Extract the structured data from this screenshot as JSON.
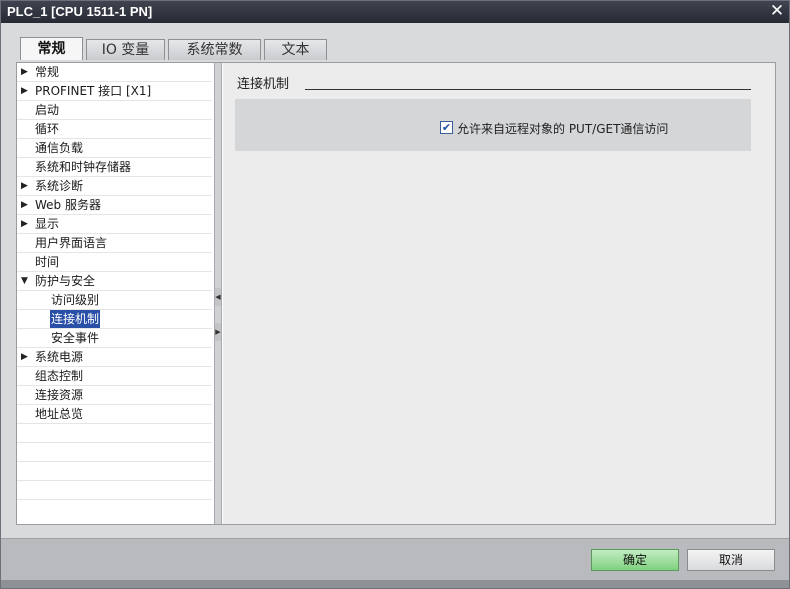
{
  "window": {
    "title": "PLC_1 [CPU 1511-1 PN]",
    "close_symbol": "✕"
  },
  "tabs": [
    {
      "label": "常规",
      "active": true
    },
    {
      "label": "IO 变量",
      "active": false
    },
    {
      "label": "系统常数",
      "active": false
    },
    {
      "label": "文本",
      "active": false
    }
  ],
  "tree": {
    "items": [
      {
        "label": "常规",
        "arrow": "▶"
      },
      {
        "label": "PROFINET 接口 [X1]",
        "arrow": "▶"
      },
      {
        "label": "启动",
        "arrow": ""
      },
      {
        "label": "循环",
        "arrow": ""
      },
      {
        "label": "通信负载",
        "arrow": ""
      },
      {
        "label": "系统和时钟存储器",
        "arrow": ""
      },
      {
        "label": "系统诊断",
        "arrow": "▶"
      },
      {
        "label": "Web 服务器",
        "arrow": "▶"
      },
      {
        "label": "显示",
        "arrow": "▶"
      },
      {
        "label": "用户界面语言",
        "arrow": ""
      },
      {
        "label": "时间",
        "arrow": ""
      },
      {
        "label": "防护与安全",
        "arrow": "▼"
      },
      {
        "label": "访问级别",
        "arrow": ""
      },
      {
        "label": "连接机制",
        "arrow": ""
      },
      {
        "label": "安全事件",
        "arrow": ""
      },
      {
        "label": "系统电源",
        "arrow": "▶"
      },
      {
        "label": "组态控制",
        "arrow": ""
      },
      {
        "label": "连接资源",
        "arrow": ""
      },
      {
        "label": "地址总览",
        "arrow": ""
      }
    ]
  },
  "splitter": {
    "collapse_left": "◀",
    "expand_right": "▶"
  },
  "main": {
    "section_title": "连接机制",
    "checkbox_checked": true,
    "checkbox_mark": "✔",
    "checkbox_label": "允许来自远程对象的 PUT/GET通信访问"
  },
  "buttons": {
    "ok_label": "确定",
    "cancel_label": "取消"
  },
  "colors": {
    "titlebar": "#2e323c",
    "selection": "#2a4fa6",
    "ok_button": "#8fd68f"
  }
}
